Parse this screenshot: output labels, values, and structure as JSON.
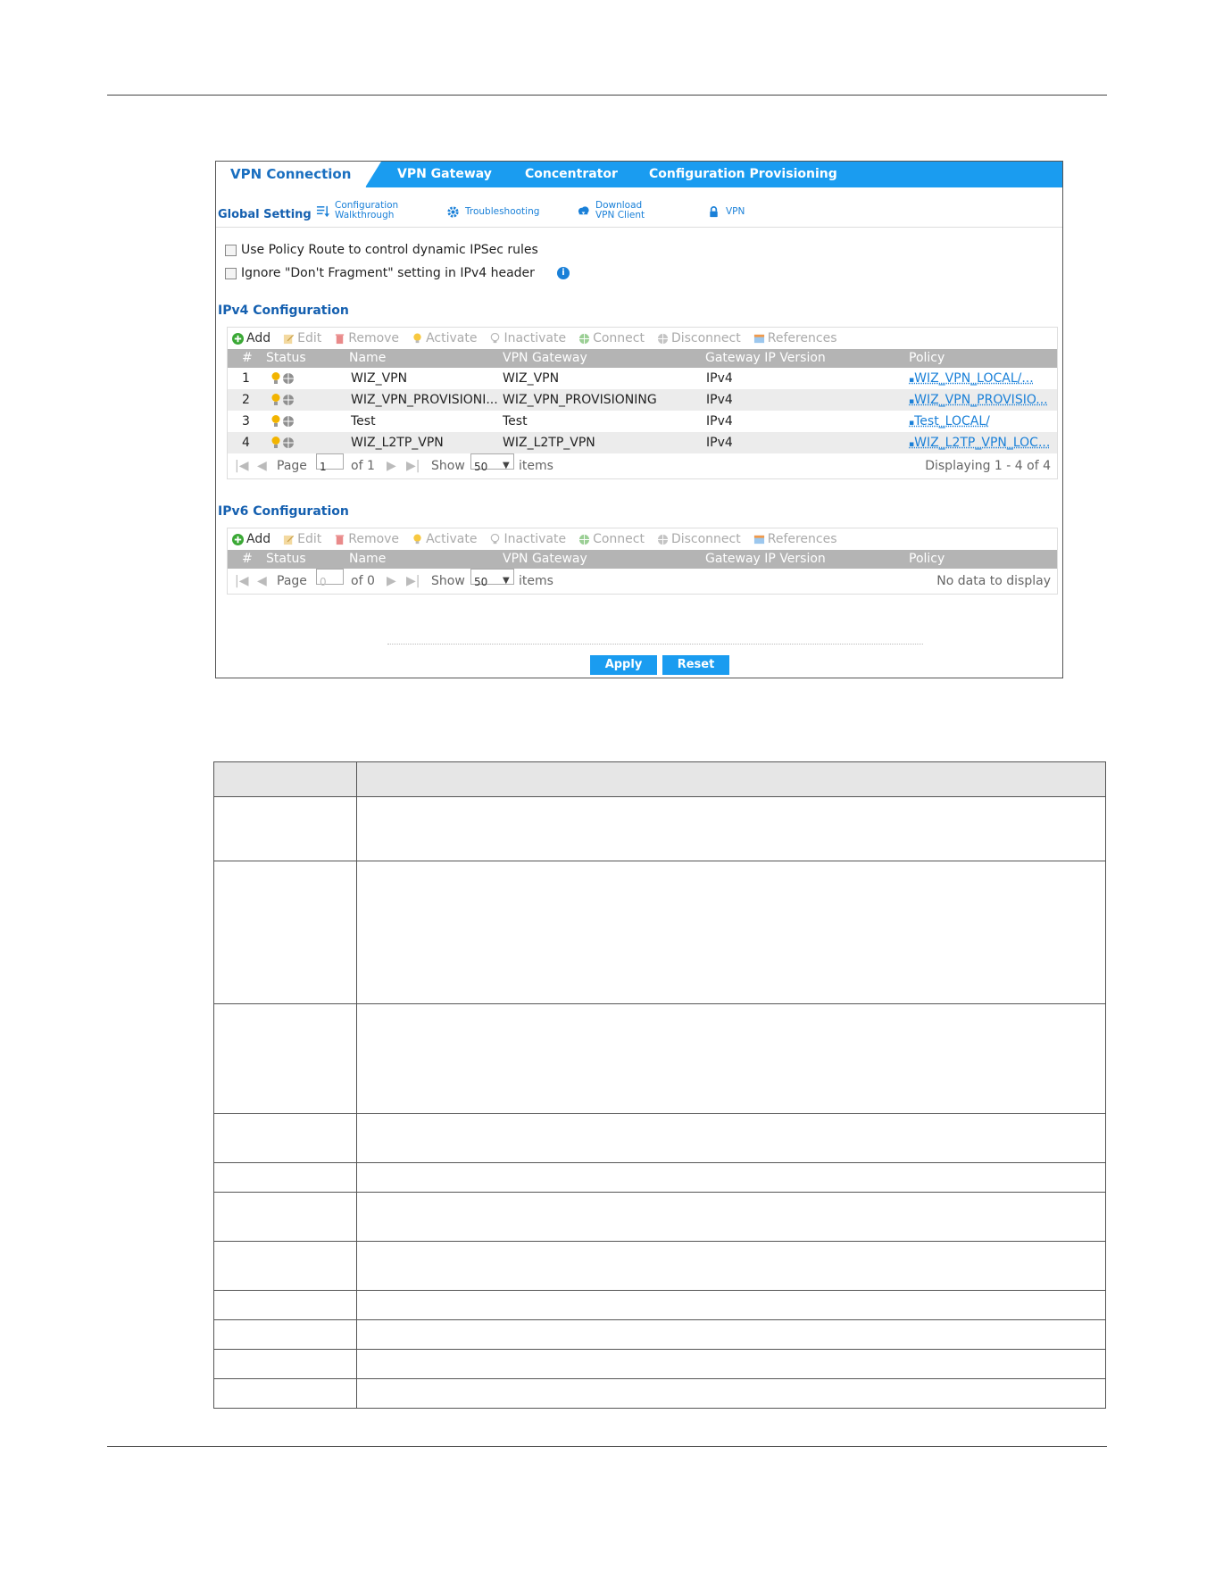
{
  "tabs": [
    "VPN Connection",
    "VPN Gateway",
    "Concentrator",
    "Configuration Provisioning"
  ],
  "global_setting": "Global Setting",
  "quick_links": [
    {
      "line1": "Configuration",
      "line2": "Walkthrough",
      "icon": "walkthrough-icon"
    },
    {
      "line1": "Troubleshooting",
      "line2": "",
      "icon": "gear-icon"
    },
    {
      "line1": "Download",
      "line2": "VPN Client",
      "icon": "cloud-download-icon"
    },
    {
      "line1": "VPN",
      "line2": "",
      "icon": "lock-icon"
    }
  ],
  "options": {
    "policy_route": "Use Policy Route to control dynamic IPSec rules",
    "dont_fragment": "Ignore \"Don't Fragment\" setting in IPv4 header"
  },
  "toolbar": {
    "add": "Add",
    "edit": "Edit",
    "remove": "Remove",
    "activate": "Activate",
    "inactivate": "Inactivate",
    "connect": "Connect",
    "disconnect": "Disconnect",
    "references": "References"
  },
  "columns": [
    "#",
    "Status",
    "Name",
    "VPN Gateway",
    "Gateway IP Version",
    "Policy"
  ],
  "ipv4": {
    "title": "IPv4 Configuration",
    "rows": [
      {
        "num": "1",
        "name": "WIZ_VPN",
        "gateway": "WIZ_VPN",
        "ipver": "IPv4",
        "policy": "WIZ_VPN_LOCAL/..."
      },
      {
        "num": "2",
        "name": "WIZ_VPN_PROVISIONI...",
        "gateway": "WIZ_VPN_PROVISIONING",
        "ipver": "IPv4",
        "policy": "WIZ_VPN_PROVISIO..."
      },
      {
        "num": "3",
        "name": "Test",
        "gateway": "Test",
        "ipver": "IPv4",
        "policy": "Test_LOCAL/"
      },
      {
        "num": "4",
        "name": "WIZ_L2TP_VPN",
        "gateway": "WIZ_L2TP_VPN",
        "ipver": "IPv4",
        "policy": "WIZ_L2TP_VPN_LOC..."
      }
    ],
    "pager": {
      "page_label": "Page",
      "page": "1",
      "of": "of 1",
      "show": "Show",
      "per_page": "50",
      "items": "items",
      "summary": "Displaying 1 - 4 of 4"
    }
  },
  "ipv6": {
    "title": "IPv6 Configuration",
    "pager": {
      "page_label": "Page",
      "page": "0",
      "of": "of 0",
      "show": "Show",
      "per_page": "50",
      "items": "items",
      "summary": "No data to display"
    }
  },
  "buttons": {
    "apply": "Apply",
    "reset": "Reset"
  },
  "colors": {
    "accent": "#1a9cf0",
    "heading": "#1560b0",
    "link": "#1a80d8",
    "header_gray": "#b4b4b4"
  }
}
